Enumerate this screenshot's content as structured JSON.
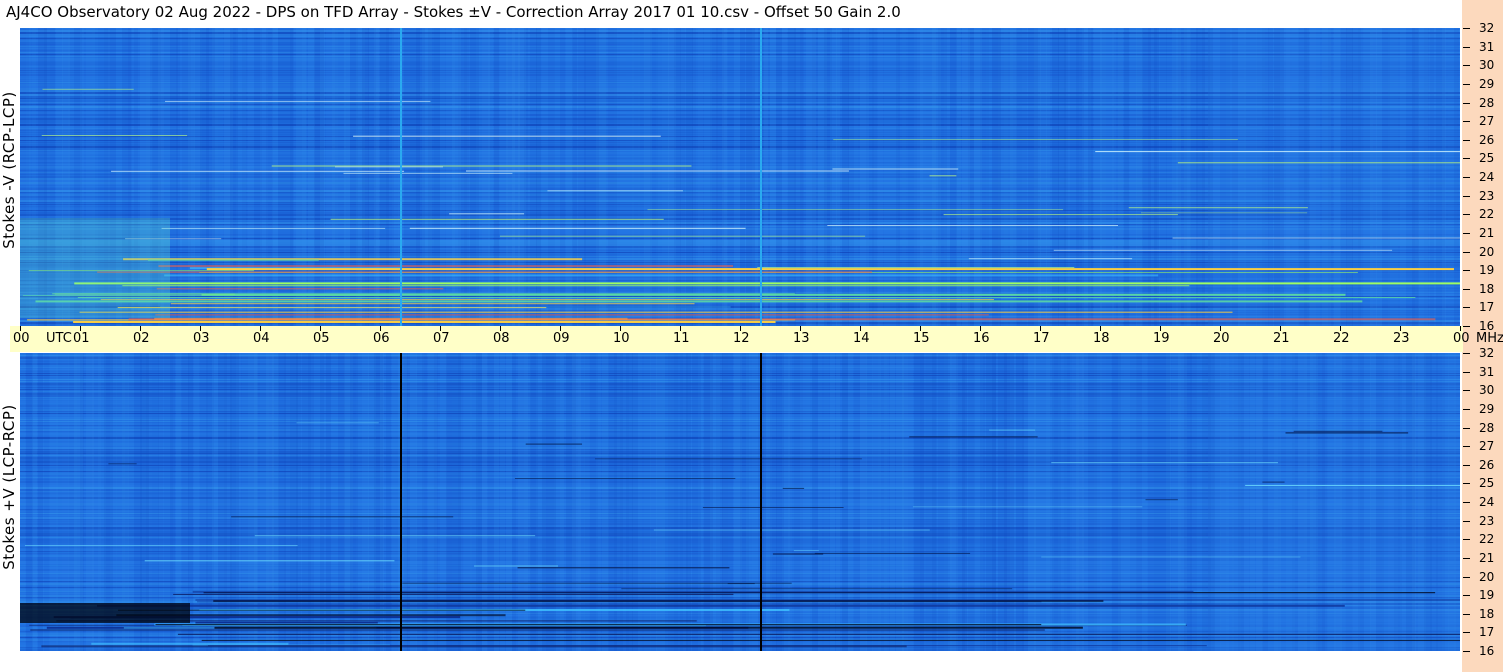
{
  "title": "AJ4CO Observatory  02 Aug 2022  -  DPS on TFD Array  -  Stokes ±V  -  Correction Array 2017 01 10.csv  -  Offset 50  Gain 2.0",
  "panels": [
    {
      "id": "top",
      "ylabel": "Stokes -V (RCP-LCP)"
    },
    {
      "id": "bottom",
      "ylabel": "Stokes +V (LCP-RCP)"
    }
  ],
  "time_axis": {
    "labels": [
      "00",
      "UTC",
      "01",
      "02",
      "03",
      "04",
      "05",
      "06",
      "07",
      "08",
      "09",
      "10",
      "11",
      "12",
      "13",
      "14",
      "15",
      "16",
      "17",
      "18",
      "19",
      "20",
      "21",
      "22",
      "23",
      "00",
      "MHz"
    ]
  },
  "freq_axis": {
    "ticks": [
      "32",
      "31",
      "30",
      "29",
      "28",
      "27",
      "26",
      "25",
      "24",
      "23",
      "22",
      "21",
      "20",
      "19",
      "18",
      "17",
      "16"
    ]
  },
  "colors": {
    "background_blue": "#1f6fe0",
    "dark_blue": "#0a32a8",
    "light_blue": "#3aa0f0",
    "time_band": "#ffffc8",
    "freq_axis_band": "#fcd9bd"
  },
  "chart_data": [
    {
      "type": "heatmap",
      "title": "AJ4CO Observatory  02 Aug 2022  -  DPS on TFD Array  -  Stokes ±V  -  Correction Array 2017 01 10.csv  -  Offset 50  Gain 2.0",
      "ylabel": "Stokes -V (RCP-LCP)",
      "xlim_utc_hours": [
        0,
        24
      ],
      "ylim_mhz": [
        16,
        32
      ],
      "x_ticks": [
        "00",
        "01",
        "02",
        "03",
        "04",
        "05",
        "06",
        "07",
        "08",
        "09",
        "10",
        "11",
        "12",
        "13",
        "14",
        "15",
        "16",
        "17",
        "18",
        "19",
        "20",
        "21",
        "22",
        "23",
        "00"
      ],
      "y_ticks": [
        32,
        31,
        30,
        29,
        28,
        27,
        26,
        25,
        24,
        23,
        22,
        21,
        20,
        19,
        18,
        17,
        16
      ],
      "vertical_lines_utc": [
        6.35,
        12.35
      ],
      "vertical_line_color": "#2aaaf0"
    },
    {
      "type": "heatmap",
      "ylabel": "Stokes +V (LCP-RCP)",
      "xlim_utc_hours": [
        0,
        24
      ],
      "ylim_mhz": [
        16,
        32
      ],
      "x_ticks": [
        "00",
        "01",
        "02",
        "03",
        "04",
        "05",
        "06",
        "07",
        "08",
        "09",
        "10",
        "11",
        "12",
        "13",
        "14",
        "15",
        "16",
        "17",
        "18",
        "19",
        "20",
        "21",
        "22",
        "23",
        "00"
      ],
      "y_ticks": [
        32,
        31,
        30,
        29,
        28,
        27,
        26,
        25,
        24,
        23,
        22,
        21,
        20,
        19,
        18,
        17,
        16
      ],
      "vertical_lines_utc": [
        6.35,
        12.35
      ],
      "vertical_line_color": "#000000"
    }
  ]
}
